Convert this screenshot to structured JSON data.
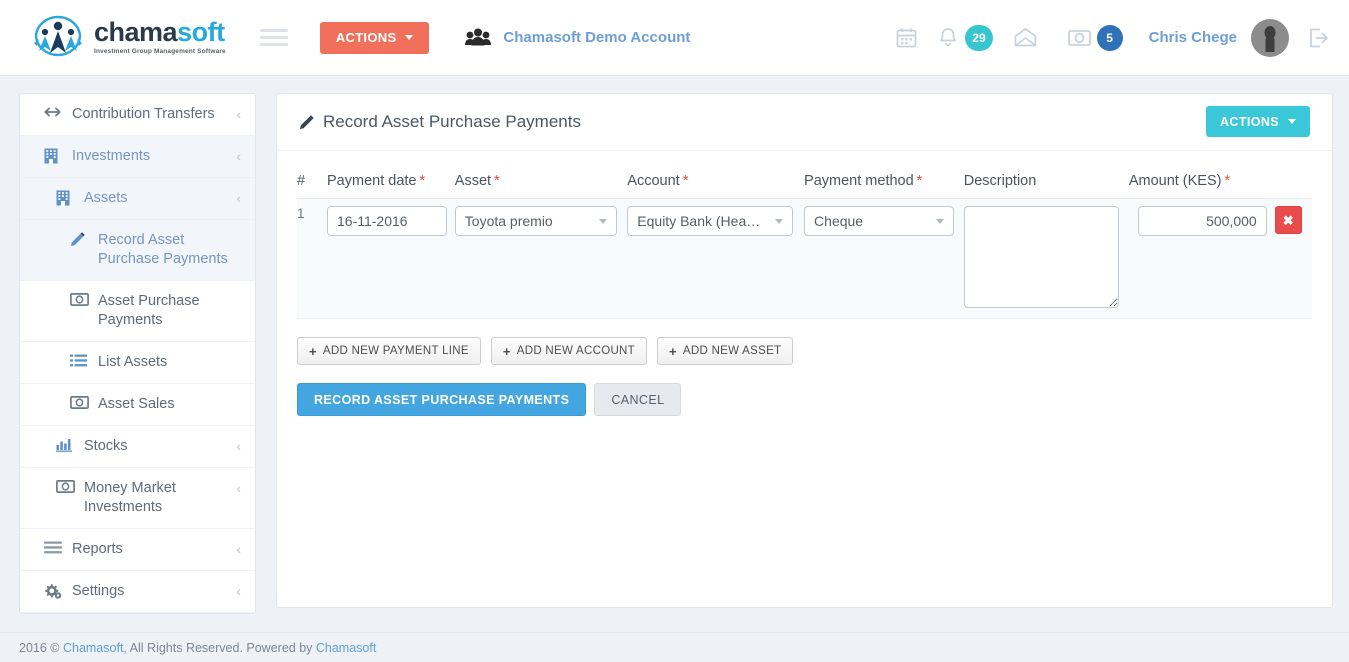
{
  "header": {
    "logo": {
      "word_primary": "chama",
      "word_secondary": "soft",
      "tagline": "Investment Group Management Software",
      "icon": "chamasoft-people-logo"
    },
    "menu_toggle_icon": "hamburger-menu-icon",
    "actions_button": {
      "label": "ACTIONS",
      "color": "#f1705b",
      "caret_icon": "chevron-down-icon"
    },
    "group": {
      "icon": "users-group-icon",
      "name": "Chamasoft Demo Account"
    },
    "right_icons": [
      {
        "name": "calendar-icon",
        "glyph": "calendar"
      },
      {
        "name": "bell-icon",
        "glyph": "bell",
        "badge": "29",
        "badge_color": "#35c6cf"
      },
      {
        "name": "envelope-icon",
        "glyph": "envelope"
      },
      {
        "name": "money-icon",
        "glyph": "money",
        "badge": "5",
        "badge_color": "#2f72b8"
      }
    ],
    "user_name": "Chris Chege",
    "avatar_icon": "user-avatar",
    "logout_icon": "logout-icon"
  },
  "sidebar": {
    "items": [
      {
        "label": "Contribution Transfers",
        "icon": "arrows-horizontal-icon",
        "level": 1,
        "active": false,
        "chevron": "‹"
      },
      {
        "label": "Investments",
        "icon": "building-icon",
        "level": 1,
        "active": true,
        "chevron": "‹"
      },
      {
        "label": "Assets",
        "icon": "building-icon",
        "level": 2,
        "active": true,
        "chevron": "‹"
      },
      {
        "label": "Record Asset Purchase Payments",
        "icon": "pencil-icon",
        "level": 3,
        "active": true,
        "chevron": ""
      },
      {
        "label": "Asset Purchase Payments",
        "icon": "money-icon",
        "level": 3,
        "active": false,
        "chevron": ""
      },
      {
        "label": "List Assets",
        "icon": "list-icon",
        "level": 3,
        "active": false,
        "chevron": ""
      },
      {
        "label": "Asset Sales",
        "icon": "money-icon",
        "level": 3,
        "active": false,
        "chevron": ""
      },
      {
        "label": "Stocks",
        "icon": "bar-chart-icon",
        "level": 2,
        "active": false,
        "chevron": "‹"
      },
      {
        "label": "Money Market Investments",
        "icon": "money-icon",
        "level": 2,
        "active": false,
        "chevron": "‹"
      },
      {
        "label": "Reports",
        "icon": "list-lines-icon",
        "level": 1,
        "active": false,
        "chevron": "‹"
      },
      {
        "label": "Settings",
        "icon": "gears-icon",
        "level": 1,
        "active": false,
        "chevron": "‹"
      }
    ]
  },
  "panel": {
    "title": "Record Asset Purchase Payments",
    "title_icon": "pencil-icon",
    "actions_button": {
      "label": "ACTIONS",
      "color": "#3ac7d7",
      "caret_icon": "chevron-down-icon"
    },
    "table": {
      "headers": [
        {
          "label": "#",
          "required": false
        },
        {
          "label": "Payment date",
          "required": true
        },
        {
          "label": "Asset",
          "required": true
        },
        {
          "label": "Account",
          "required": true
        },
        {
          "label": "Payment method",
          "required": true
        },
        {
          "label": "Description",
          "required": false
        },
        {
          "label": "Amount (KES)",
          "required": true
        }
      ],
      "required_marker": "*",
      "rows": [
        {
          "number": "1",
          "payment_date": "16-11-2016",
          "asset": "Toyota premio",
          "account": "Equity Bank (Hea…",
          "payment_method": "Cheque",
          "description": "",
          "amount": "500,000",
          "delete_label": "✖"
        }
      ]
    },
    "add_buttons": [
      {
        "label": "ADD NEW PAYMENT LINE",
        "icon": "plus-icon"
      },
      {
        "label": "ADD NEW ACCOUNT",
        "icon": "plus-icon"
      },
      {
        "label": "ADD NEW ASSET",
        "icon": "plus-icon"
      }
    ],
    "submit_button": "RECORD ASSET PURCHASE PAYMENTS",
    "cancel_button": "CANCEL"
  },
  "footer": {
    "text_before": "2016 © ",
    "link1": "Chamasoft",
    "text_middle": ", All Rights Reserved. Powered by ",
    "link2": "Chamasoft"
  }
}
